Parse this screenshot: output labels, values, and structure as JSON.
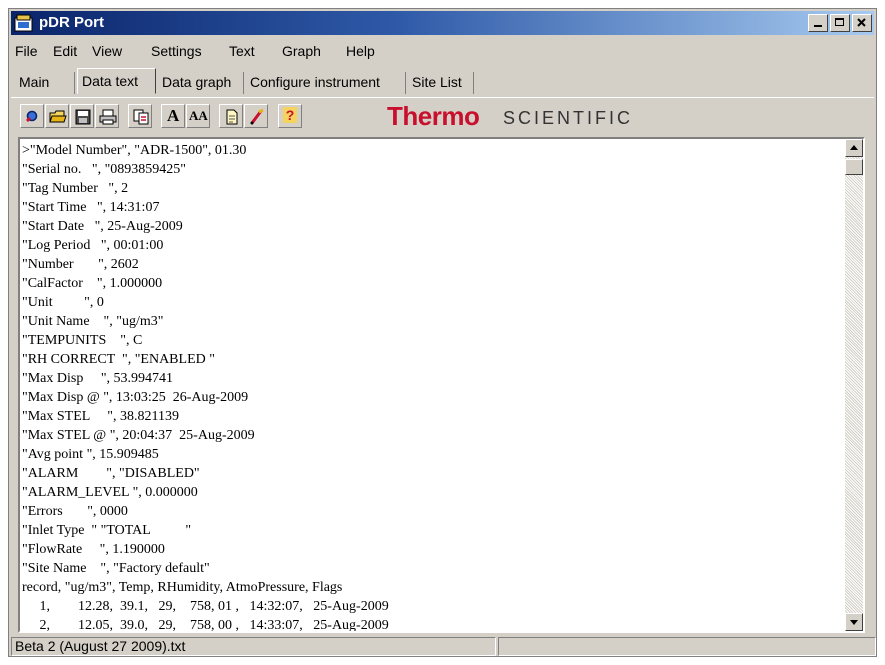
{
  "window": {
    "title": "pDR Port",
    "controls": {
      "minimize": "_",
      "maximize": "□",
      "close": "x"
    }
  },
  "menu": [
    "File",
    "Edit",
    "View",
    "Settings",
    "Text",
    "Graph",
    "Help"
  ],
  "tabs": [
    {
      "label": "Main",
      "active": false
    },
    {
      "label": "Data text",
      "active": true
    },
    {
      "label": "Data graph",
      "active": false
    },
    {
      "label": "Configure instrument",
      "active": false
    },
    {
      "label": "Site List",
      "active": false
    }
  ],
  "toolbar": {
    "tools": [
      "search-icon",
      "open-folder-icon",
      "save-icon",
      "print-icon",
      "copy-icon",
      "font-icon",
      "font-size-icon",
      "document-icon",
      "highlight-icon",
      "help-icon"
    ],
    "font_label": "A",
    "font_size_label": "AA",
    "help_label": "?",
    "brand_strong": "Thermo",
    "brand_light": "SCIENTIFIC",
    "brand_color": "#c8102e"
  },
  "data_text": {
    "lines": [
      ">\"Model Number\", \"ADR-1500\", 01.30",
      "\"Serial no.   \", \"0893859425\"",
      "\"Tag Number   \", 2",
      "\"Start Time   \", 14:31:07",
      "\"Start Date   \", 25-Aug-2009",
      "\"Log Period   \", 00:01:00",
      "\"Number       \", 2602",
      "\"CalFactor    \", 1.000000",
      "\"Unit         \", 0",
      "\"Unit Name    \", \"ug/m3\"",
      "\"TEMPUNITS    \", C",
      "\"RH CORRECT  \", \"ENABLED \"",
      "\"Max Disp     \", 53.994741",
      "\"Max Disp @ \", 13:03:25  26-Aug-2009",
      "\"Max STEL     \", 38.821139",
      "\"Max STEL @ \", 20:04:37  25-Aug-2009",
      "\"Avg point \", 15.909485",
      "\"ALARM        \", \"DISABLED\"",
      "\"ALARM_LEVEL \", 0.000000",
      "\"Errors       \", 0000",
      "\"Inlet Type  \" \"TOTAL          \"",
      "\"FlowRate     \", 1.190000",
      "\"Site Name    \", \"Factory default\"",
      "record, \"ug/m3\", Temp, RHumidity, AtmoPressure, Flags",
      "     1,        12.28,  39.1,   29,    758, 01 ,   14:32:07,   25-Aug-2009",
      "     2,        12.05,  39.0,   29,    758, 00 ,   14:33:07,   25-Aug-2009"
    ]
  },
  "statusbar": {
    "file": "Beta 2 (August 27 2009).txt",
    "extra": ""
  }
}
